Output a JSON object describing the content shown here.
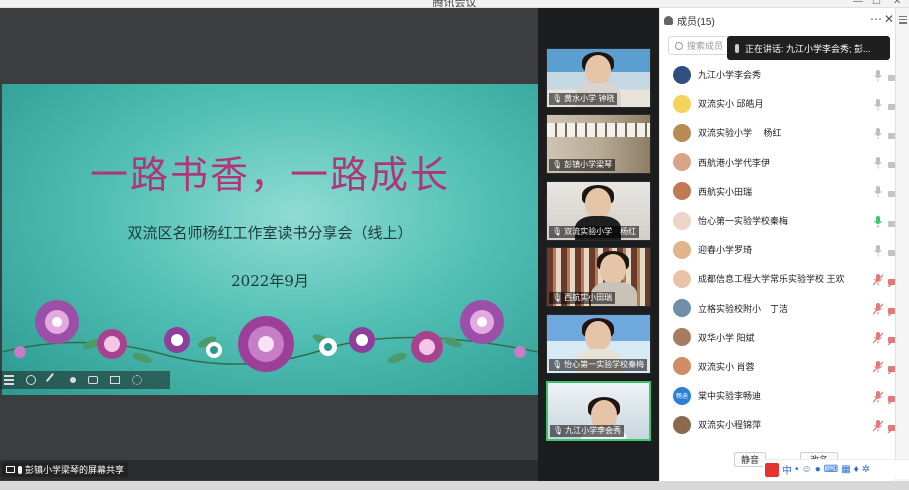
{
  "window": {
    "title": "腾讯会议"
  },
  "slide": {
    "title": "一路书香，一路成长",
    "subtitle": "双流区名师杨红工作室读书分享会（线上）",
    "date": "2022年9月"
  },
  "gallery": {
    "tiles": [
      {
        "label": "黄水小学 钟晓",
        "active": false
      },
      {
        "label": "彭镇小学梁琴",
        "active": false
      },
      {
        "label": "双流实验小学　杨红",
        "active": false
      },
      {
        "label": "西航实小田瑞",
        "active": false
      },
      {
        "label": "怡心第一实验学校秦梅",
        "active": false
      },
      {
        "label": "九江小学李会秀",
        "active": true
      }
    ]
  },
  "status": {
    "share_text": "彭镇小学梁琴的屏幕共享"
  },
  "panel": {
    "title": "成员(15)",
    "search_placeholder": "搜索成员",
    "speaking_tip": "正在讲话: 九江小学李会秀; 彭...",
    "members": [
      {
        "name": "九江小学李会秀",
        "mic": "on"
      },
      {
        "name": "双流实小 邱皓月",
        "mic": "on"
      },
      {
        "name": "双流实验小学　 杨红",
        "mic": "on"
      },
      {
        "name": "西航港小学代李伊",
        "mic": "on"
      },
      {
        "name": "西航实小田瑞",
        "mic": "on"
      },
      {
        "name": "怡心第一实验学校秦梅",
        "mic": "speaking"
      },
      {
        "name": "迎春小学罗琦",
        "mic": "on"
      },
      {
        "name": "成都信息工程大学常乐实验学校 王欢",
        "mic": "muted"
      },
      {
        "name": "立格实验校附小　丁洁",
        "mic": "muted"
      },
      {
        "name": "双华小学 阳斌",
        "mic": "muted"
      },
      {
        "name": "双流实小 肖蓉",
        "mic": "muted"
      },
      {
        "name": "棠中实验李畅迪",
        "mic": "muted",
        "avatar_text": "畅迪"
      },
      {
        "name": "双流实小程锦萍",
        "mic": "muted"
      }
    ],
    "mute_all_label": "静音",
    "rename_label": "改名"
  },
  "colors": {
    "title_magenta": "#b0367c",
    "slide_teal": "#52c0b5",
    "active_green": "#3cc46b"
  }
}
